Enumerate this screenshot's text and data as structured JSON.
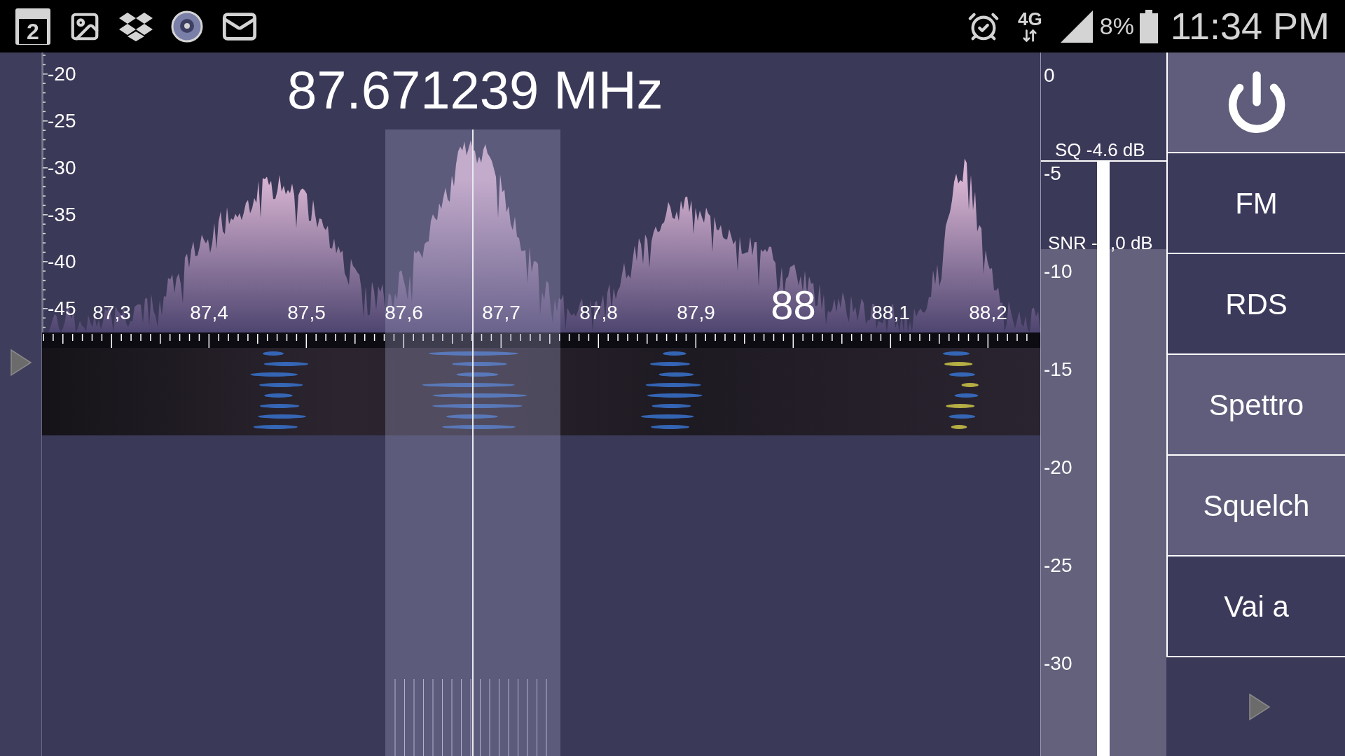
{
  "status_bar": {
    "calendar_day": "2",
    "network": "4G",
    "battery": "8%",
    "time": "11:34 PM"
  },
  "frequency": "87.671239 MHz",
  "db_axis": [
    "-20",
    "-25",
    "-30",
    "-35",
    "-40",
    "-45"
  ],
  "freq_axis": [
    {
      "label": "87,3",
      "kind": "minor"
    },
    {
      "label": "87,4",
      "kind": "minor"
    },
    {
      "label": "87,5",
      "kind": "minor"
    },
    {
      "label": "87,6",
      "kind": "minor"
    },
    {
      "label": "87,7",
      "kind": "minor"
    },
    {
      "label": "87,8",
      "kind": "minor"
    },
    {
      "label": "87,9",
      "kind": "minor"
    },
    {
      "label": "88",
      "kind": "major"
    },
    {
      "label": "88,1",
      "kind": "minor"
    },
    {
      "label": "88,2",
      "kind": "minor"
    }
  ],
  "meter": {
    "scale": [
      "0",
      "-5",
      "-10",
      "-15",
      "-20",
      "-25",
      "-30"
    ],
    "squelch_label": "SQ -4.6 dB",
    "snr_label_start": "SNR -",
    "snr_label_end": ",0 dB",
    "snr": {
      "level": 0.72
    },
    "signal": {
      "level": 0.846
    }
  },
  "buttons": [
    {
      "kind": "power",
      "selected": true
    },
    {
      "kind": "text",
      "label": "FM",
      "selected": false
    },
    {
      "kind": "text",
      "label": "RDS",
      "selected": false
    },
    {
      "kind": "text",
      "label": "Spettro",
      "selected": true
    },
    {
      "kind": "text",
      "label": "Squelch",
      "selected": true
    },
    {
      "kind": "text",
      "label": "Vai a",
      "selected": false
    }
  ]
}
